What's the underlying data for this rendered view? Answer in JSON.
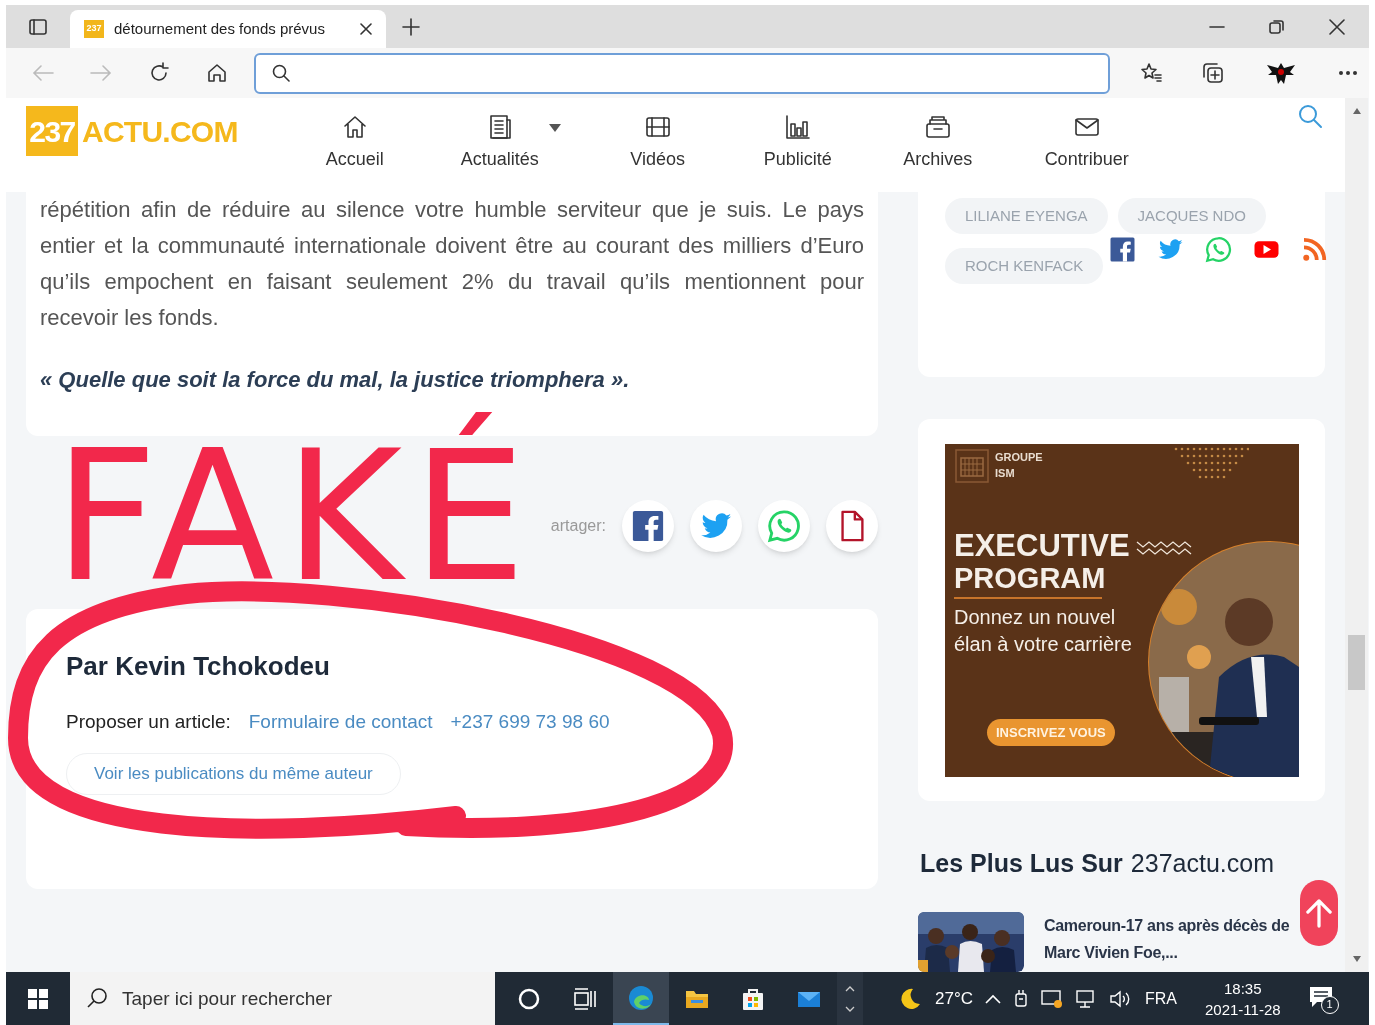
{
  "browser": {
    "tab": {
      "title": "détournement des fonds prévus",
      "favicon": "237",
      "selected": true
    }
  },
  "site": {
    "logo": {
      "number": "237",
      "name": "ACTU.COM"
    },
    "nav": [
      {
        "label": "Accueil",
        "dropdown": false
      },
      {
        "label": "Actualités",
        "dropdown": true
      },
      {
        "label": "Vidéos",
        "dropdown": false
      },
      {
        "label": "Publicité",
        "dropdown": false
      },
      {
        "label": "Archives",
        "dropdown": false
      },
      {
        "label": "Contribuer",
        "dropdown": false
      }
    ]
  },
  "article": {
    "paragraph": "répétition afin de réduire au silence votre humble serviteur que je suis. Le pays entier et la communauté internationale doivent être au courant des milliers d’Euro qu’ils empochent en faisant seulement 2% du travail qu’ils mentionnent pour recevoir les fonds.",
    "quote": "« Quelle que soit la force du mal, la justice triomphera ».",
    "share_label": "artager:",
    "share": [
      {
        "kind": "facebook"
      },
      {
        "kind": "twitter"
      },
      {
        "kind": "whatsapp"
      },
      {
        "kind": "document"
      }
    ],
    "author": {
      "byline": "Par Kevin Tchokodeu",
      "propose_label": "Proposer un article:",
      "links": [
        "Formulaire de contact",
        "+237 699 73 98 60"
      ],
      "more_button": "Voir les publications du même auteur"
    }
  },
  "annotation": {
    "text": "FAKÉ"
  },
  "sidebar": {
    "tags": [
      "LILIANE EYENGA",
      "JACQUES NDO",
      "ROCH KENFACK"
    ],
    "social": [
      {
        "kind": "facebook"
      },
      {
        "kind": "twitter"
      },
      {
        "kind": "whatsapp"
      },
      {
        "kind": "youtube"
      },
      {
        "kind": "rss"
      }
    ],
    "ad": {
      "brand": [
        "GROUPE",
        "ISM"
      ],
      "headline": [
        "EXECUTIVE",
        "PROGRAM"
      ],
      "body": "Donnez un nouvel élan à votre carrière",
      "cta": "INSCRIVEZ VOUS"
    },
    "most_read": {
      "title_bold": "Les Plus Lus Sur",
      "title_rest": "237actu.com",
      "items": [
        {
          "title": "Cameroun-17 ans après décès de Marc Vivien Foe,...",
          "kind": "picture"
        }
      ]
    }
  },
  "taskbar": {
    "search_placeholder": "Taper ici pour rechercher",
    "apps": [
      {
        "kind": "cortana",
        "active": false
      },
      {
        "kind": "taskview",
        "active": false
      },
      {
        "kind": "edge",
        "active": true
      },
      {
        "kind": "explorer",
        "active": false
      },
      {
        "kind": "store",
        "active": false
      },
      {
        "kind": "mail",
        "active": false
      }
    ],
    "temperature": "27°C",
    "language": "FRA",
    "time": "18:35",
    "date": "2021-11-28",
    "notifications": "1"
  }
}
